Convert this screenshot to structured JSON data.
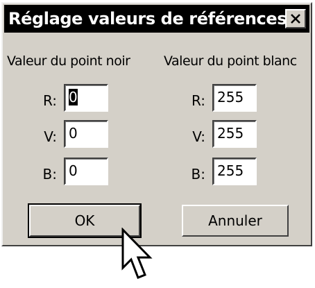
{
  "dialog": {
    "title": "Réglage valeurs de références",
    "close_glyph": "✕"
  },
  "black_point": {
    "label": "Valeur du point noir",
    "channels": [
      {
        "label": "R:",
        "value": "0"
      },
      {
        "label": "V:",
        "value": "0"
      },
      {
        "label": "B:",
        "value": "0"
      }
    ]
  },
  "white_point": {
    "label": "Valeur du point blanc",
    "channels": [
      {
        "label": "R:",
        "value": "255"
      },
      {
        "label": "V:",
        "value": "255"
      },
      {
        "label": "B:",
        "value": "255"
      }
    ]
  },
  "buttons": {
    "ok": "OK",
    "cancel": "Annuler"
  },
  "icons": {
    "close": "close-icon",
    "pointer": "mouse-pointer-icon"
  }
}
